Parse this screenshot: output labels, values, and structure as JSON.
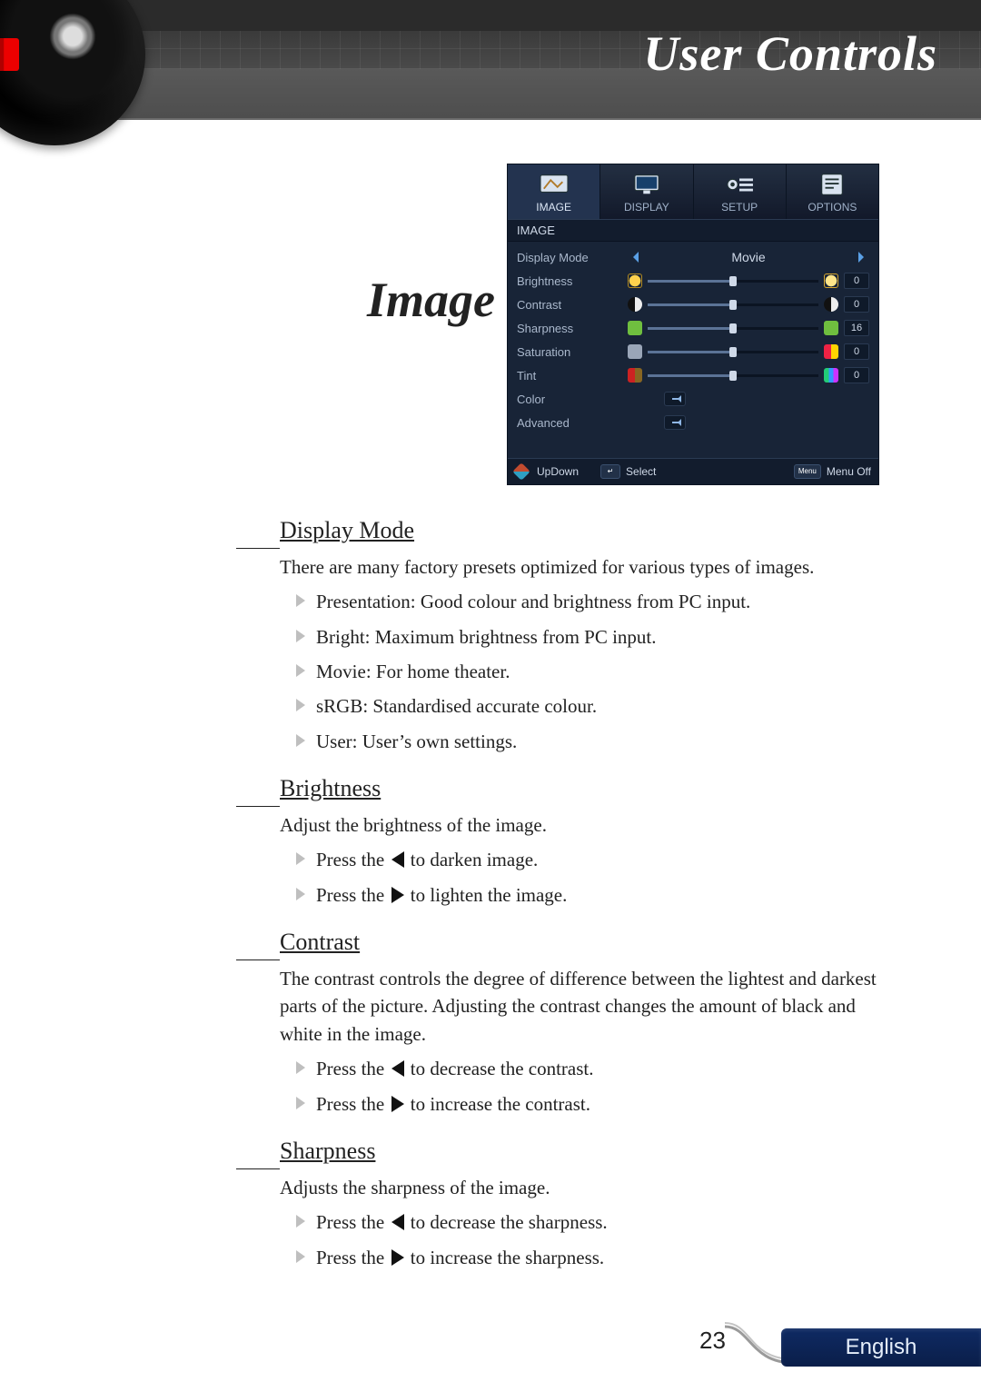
{
  "header": {
    "title": "User Controls"
  },
  "section_title": "Image",
  "osd": {
    "tabs": {
      "image": "IMAGE",
      "display": "DISPLAY",
      "setup": "SETUP",
      "options": "OPTIONS"
    },
    "section_label": "IMAGE",
    "rows": {
      "display_mode": {
        "label": "Display Mode",
        "value": "Movie"
      },
      "brightness": {
        "label": "Brightness",
        "value": "0"
      },
      "contrast": {
        "label": "Contrast",
        "value": "0"
      },
      "sharpness": {
        "label": "Sharpness",
        "value": "16"
      },
      "saturation": {
        "label": "Saturation",
        "value": "0"
      },
      "tint": {
        "label": "Tint",
        "value": "0"
      },
      "color": {
        "label": "Color"
      },
      "advanced": {
        "label": "Advanced"
      }
    },
    "footer": {
      "updown": "UpDown",
      "select": "Select",
      "menuoff": "Menu Off",
      "menu_key": "Menu"
    }
  },
  "doc": {
    "display_mode": {
      "heading": "Display Mode",
      "intro": "There are many factory presets optimized for various types of images.",
      "items": {
        "presentation": "Presentation: Good colour and brightness from PC input.",
        "bright": "Bright: Maximum brightness from PC input.",
        "movie": "Movie: For home theater.",
        "srgb": "sRGB: Standardised accurate colour.",
        "user": "User: User’s own settings."
      }
    },
    "brightness": {
      "heading": "Brightness",
      "intro": "Adjust the brightness of the image.",
      "left": {
        "pre": "Press the ",
        "post": " to darken image."
      },
      "right": {
        "pre": "Press the ",
        "post": " to lighten the image."
      }
    },
    "contrast": {
      "heading": "Contrast",
      "intro": "The contrast controls the degree of difference between the lightest and darkest parts of the picture. Adjusting the contrast changes the amount of black and white in the image.",
      "left": {
        "pre": "Press the ",
        "post": " to decrease the contrast."
      },
      "right": {
        "pre": "Press the ",
        "post": " to increase the contrast."
      }
    },
    "sharpness": {
      "heading": "Sharpness",
      "intro": "Adjusts the sharpness of the image.",
      "left": {
        "pre": "Press the ",
        "post": " to decrease the sharpness."
      },
      "right": {
        "pre": "Press the ",
        "post": " to increase the sharpness."
      }
    }
  },
  "footer": {
    "page": "23",
    "language": "English"
  }
}
